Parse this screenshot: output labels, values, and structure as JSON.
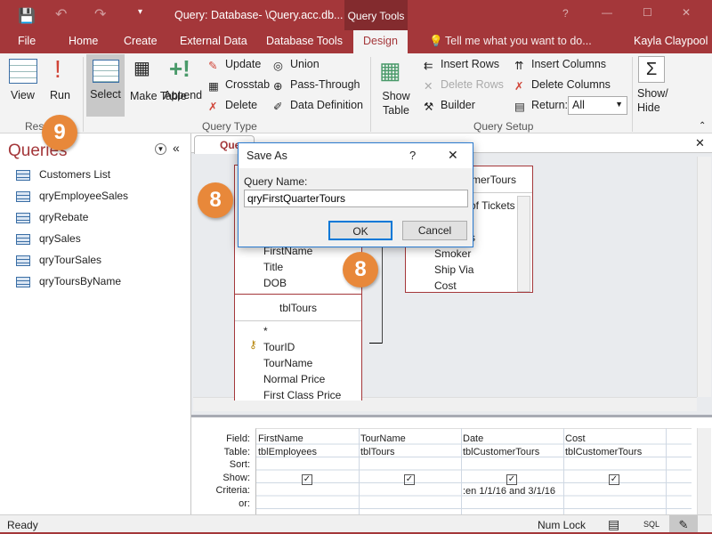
{
  "titlebar": {
    "title": "Query: Database- \\Query.acc.db...",
    "context_tab": "Query Tools",
    "help": "?",
    "minimize": "—",
    "maximize": "☐",
    "close": "✕"
  },
  "tabs": [
    {
      "label": "File"
    },
    {
      "label": "Home"
    },
    {
      "label": "Create"
    },
    {
      "label": "External Data"
    },
    {
      "label": "Database Tools"
    },
    {
      "label": "Design",
      "active": true
    }
  ],
  "tell_me": "Tell me what you want to do...",
  "user": "Kayla Claypool",
  "ribbon": {
    "view": "View",
    "run": "Run",
    "select": "Select",
    "make_table": "Make Table",
    "append": "Append",
    "update": "Update",
    "crosstab": "Crosstab",
    "delete": "Delete",
    "union": "Union",
    "pass_through": "Pass-Through",
    "data_definition": "Data Definition",
    "show_table": "Show Table",
    "insert_rows": "Insert Rows",
    "delete_rows": "Delete Rows",
    "builder": "Builder",
    "insert_columns": "Insert Columns",
    "delete_columns": "Delete Columns",
    "return_label": "Return:",
    "return_value": "All",
    "show_hide": "Show/ Hide",
    "groups": {
      "results": "Resu",
      "query_type": "Query Type",
      "query_setup": "Query Setup"
    }
  },
  "nav": {
    "title": "Queries",
    "items": [
      "Customers List",
      "qryEmployeeSales",
      "qryRebate",
      "qrySales",
      "qryTourSales",
      "qryToursByName"
    ]
  },
  "doc_tab": "Que",
  "tables": {
    "employees": {
      "fields": [
        "FirstName",
        "Title",
        "DOB"
      ]
    },
    "tours": {
      "name": "tblTours",
      "fields": [
        "*",
        "TourID",
        "TourName",
        "Normal Price",
        "First Class Price"
      ]
    },
    "customer_tours": {
      "name": "merTours",
      "fields": [
        "of Tickets",
        "s",
        "Smoker",
        "Ship Via",
        "Cost"
      ]
    }
  },
  "dialog": {
    "title": "Save As",
    "help": "?",
    "close": "✕",
    "label": "Query Name:",
    "value": "qryFirstQuarterTours",
    "ok": "OK",
    "cancel": "Cancel"
  },
  "callouts": [
    "9",
    "8",
    "8"
  ],
  "grid": {
    "row_labels": [
      "Field:",
      "Table:",
      "Sort:",
      "Show:",
      "Criteria:",
      "or:"
    ],
    "columns": [
      {
        "field": "FirstName",
        "table": "tblEmployees",
        "show": true,
        "criteria": ""
      },
      {
        "field": "TourName",
        "table": "tblTours",
        "show": true,
        "criteria": ""
      },
      {
        "field": "Date",
        "table": "tblCustomerTours",
        "show": true,
        "criteria": ":en 1/1/16 and 3/1/16"
      },
      {
        "field": "Cost",
        "table": "tblCustomerTours",
        "show": true,
        "criteria": ""
      }
    ]
  },
  "status": {
    "left": "Ready",
    "num_lock": "Num Lock",
    "sql": "SQL"
  },
  "colors": {
    "accent": "#a4373a",
    "callout": "#e8883a"
  }
}
